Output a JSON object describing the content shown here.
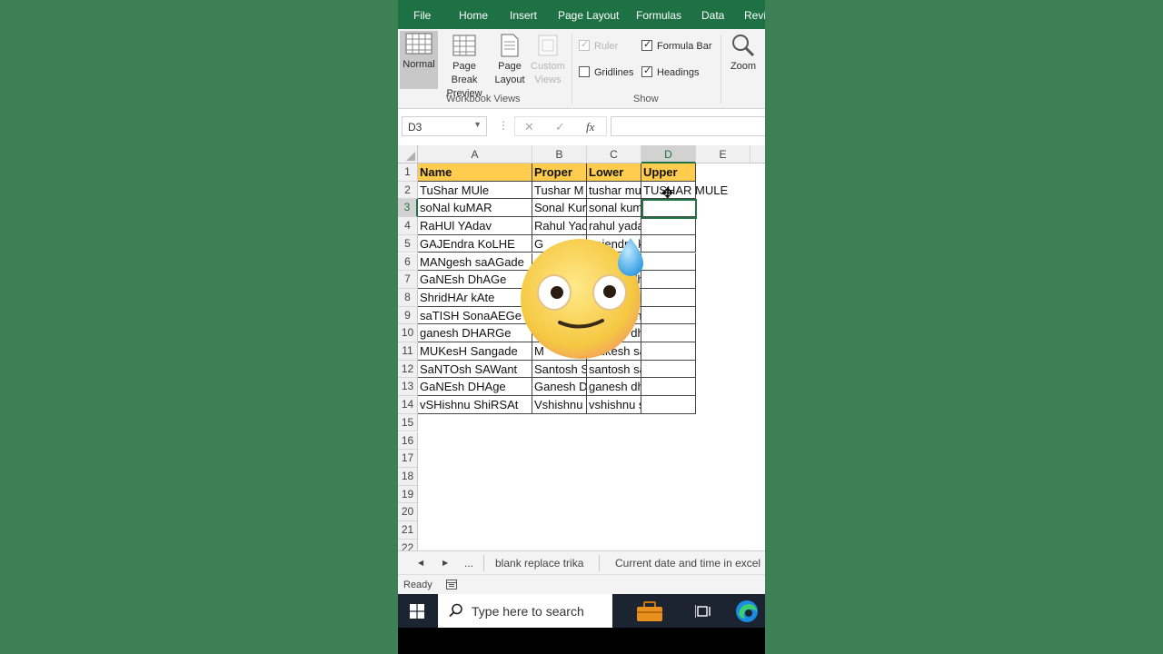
{
  "ribbon_tabs": [
    "File",
    "Home",
    "Insert",
    "Page Layout",
    "Formulas",
    "Data",
    "Revi"
  ],
  "views": {
    "normal": "Normal",
    "page_break_l1": "Page Break",
    "page_break_l2": "Preview",
    "page_layout_l1": "Page",
    "page_layout_l2": "Layout",
    "custom_l1": "Custom",
    "custom_l2": "Views",
    "group_label": "Workbook Views"
  },
  "show": {
    "ruler": "Ruler",
    "formula_bar": "Formula Bar",
    "gridlines": "Gridlines",
    "headings": "Headings",
    "group_label": "Show",
    "ruler_checked": true,
    "formula_bar_checked": true,
    "gridlines_checked": false,
    "headings_checked": true
  },
  "zoom_label": "Zoom",
  "formula_bar": {
    "name_box": "D3",
    "cancel_icon": "✕",
    "enter_icon": "✓",
    "fx": "fx",
    "value": ""
  },
  "columns": [
    "A",
    "B",
    "C",
    "D",
    "E"
  ],
  "rows": [
    "1",
    "2",
    "3",
    "4",
    "5",
    "6",
    "7",
    "8",
    "9",
    "10",
    "11",
    "12",
    "13",
    "14",
    "15",
    "16",
    "17",
    "18",
    "19",
    "20",
    "21",
    "22"
  ],
  "table": {
    "headers": [
      "Name",
      "Proper",
      "Lower",
      "Upper"
    ],
    "data": [
      [
        "TuShar MUle",
        "Tushar M",
        "tushar mu",
        "TUSHAR MULE"
      ],
      [
        "soNal kuMAR",
        "Sonal Kur",
        "sonal kumar",
        ""
      ],
      [
        "RaHUl YAdav",
        "Rahul Yad",
        "rahul yadav",
        ""
      ],
      [
        "GAJEndra KoLHE",
        "G",
        "gajendra kolhe",
        ""
      ],
      [
        "MANgesh saAGade",
        "",
        "mangesh saagade",
        ""
      ],
      [
        "GaNEsh DhAGe",
        "",
        "ganesh dhage",
        ""
      ],
      [
        "ShridHAr kAte",
        "",
        "shridhar kate",
        ""
      ],
      [
        "saTISH SonaAEGe",
        "",
        "satish sonaaege",
        ""
      ],
      [
        "ganesh DHARGe",
        "",
        "ganesh dharge",
        ""
      ],
      [
        "MUKesH Sangade",
        "M",
        "mukesh sangade",
        ""
      ],
      [
        "SaNTOsh SAWant",
        "Santosh S",
        "santosh sawant",
        ""
      ],
      [
        "GaNEsh DHAge",
        "Ganesh D",
        "ganesh dhage",
        ""
      ],
      [
        "vSHishnu ShiRSAt",
        "Vshishnu",
        "vshishnu shirsat",
        ""
      ]
    ]
  },
  "sheet_tabs": {
    "nav_prev": "◀",
    "nav_next": "▶",
    "more": "...",
    "tab1": "blank replace trika",
    "tab2": "Current date and time in excel"
  },
  "status": "Ready",
  "taskbar": {
    "search_placeholder": "Type here to search"
  },
  "colors": {
    "accent": "#217346",
    "header_fill": "#ffcc4d",
    "background": "#3e8056"
  }
}
